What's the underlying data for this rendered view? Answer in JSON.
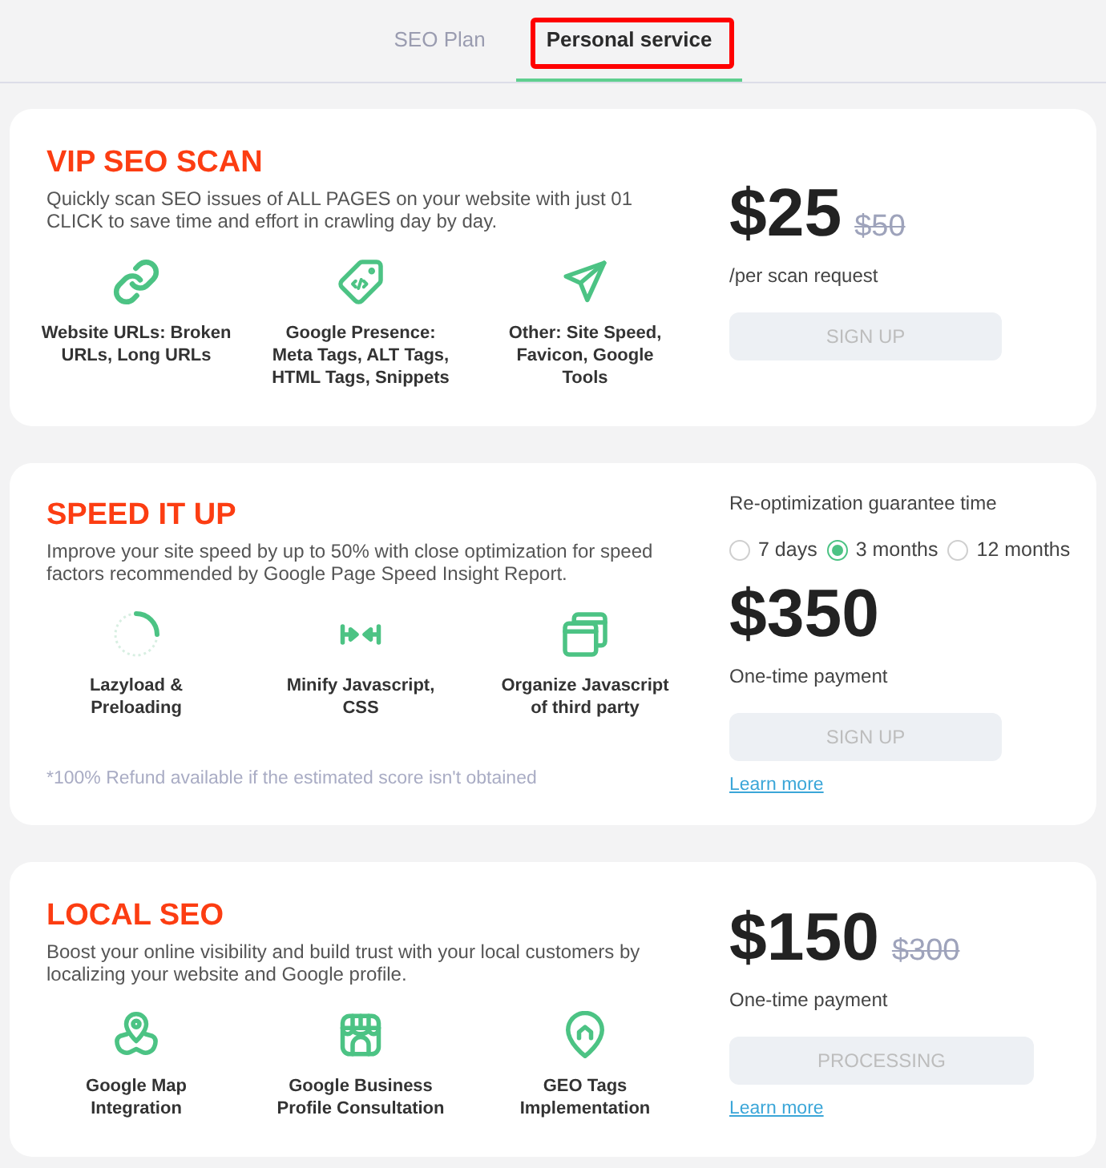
{
  "tabs": [
    {
      "label": "SEO Plan",
      "selected": false,
      "highlighted": false
    },
    {
      "label": "Personal service",
      "selected": true,
      "highlighted": true
    }
  ],
  "plans": [
    {
      "title": "VIP SEO SCAN",
      "description": "Quickly scan SEO issues of ALL PAGES on your website with just 01 CLICK to save time and effort in crawling day by day.",
      "features": [
        "Website URLs: Broken URLs, Long URLs",
        "Google Presence: Meta Tags, ALT Tags, HTML Tags, Snippets",
        "Other: Site Speed, Favicon, Google Tools"
      ],
      "price": "$25",
      "old_price": "$50",
      "price_note": "/per scan request",
      "button": {
        "label": "SIGN UP",
        "disabled": true
      }
    },
    {
      "title": "SPEED IT UP",
      "description": "Improve your site speed by up to 50% with close optimization for speed factors recommended by Google Page Speed Insight Report.",
      "features": [
        "Lazyload & Preloading",
        "Minify Javascript, CSS",
        "Organize Javascript of third party"
      ],
      "note": "*100% Refund available if the estimated score isn't obtained",
      "guarantee": {
        "label": "Re-optimization guarantee time",
        "options": [
          {
            "label": "7 days",
            "selected": false
          },
          {
            "label": "3 months",
            "selected": true
          },
          {
            "label": "12 months",
            "selected": false
          }
        ]
      },
      "price": "$350",
      "price_note": "One-time payment",
      "button": {
        "label": "SIGN UP",
        "disabled": true
      },
      "link": "Learn more"
    },
    {
      "title": "LOCAL SEO",
      "description": "Boost your online visibility and build trust with your local customers by localizing your website and Google profile.",
      "features": [
        "Google Map Integration",
        "Google Business Profile Consultation",
        "GEO Tags Implementation"
      ],
      "price": "$150",
      "old_price": "$300",
      "price_note": "One-time payment",
      "button": {
        "label": "PROCESSING",
        "disabled": true
      },
      "link": "Learn more"
    }
  ]
}
